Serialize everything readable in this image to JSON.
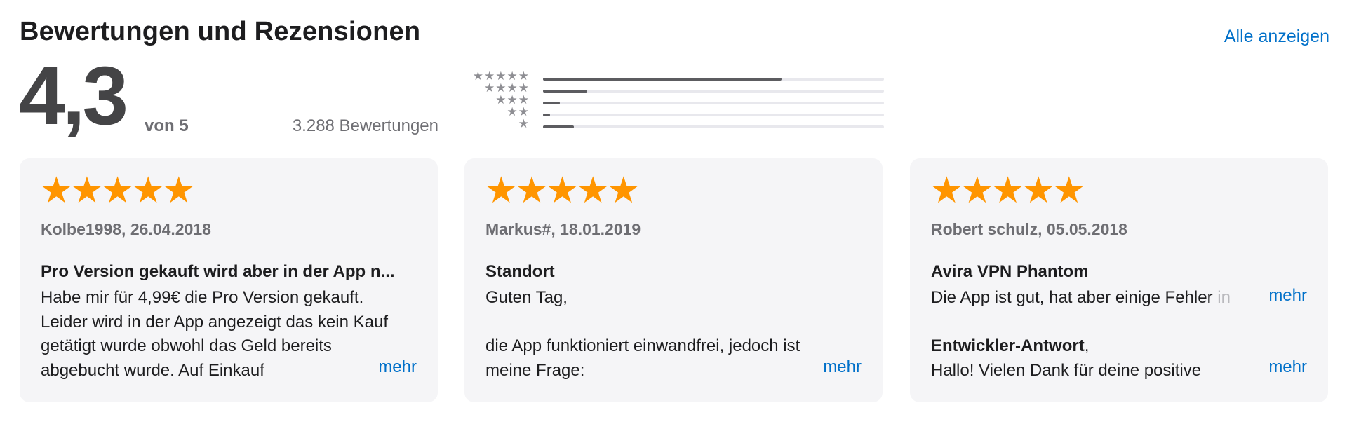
{
  "header": {
    "title": "Bewertungen und Rezensionen",
    "see_all": "Alle anzeigen"
  },
  "summary": {
    "rating": "4,3",
    "out_of": "von 5",
    "count": "3.288 Bewertungen",
    "histogram": [
      {
        "stars": 5,
        "label": "★★★★★",
        "fraction": 0.7
      },
      {
        "stars": 4,
        "label": "★★★★",
        "fraction": 0.13
      },
      {
        "stars": 3,
        "label": "★★★",
        "fraction": 0.05
      },
      {
        "stars": 2,
        "label": "★★",
        "fraction": 0.02
      },
      {
        "stars": 1,
        "label": "★",
        "fraction": 0.09
      }
    ]
  },
  "colors": {
    "accent": "#0070c9",
    "star": "#ff9500",
    "card_bg": "#f5f5f7"
  },
  "reviews": [
    {
      "stars": 5,
      "stars_text": "★★★★★",
      "meta": "Kolbe1998, 26.04.2018",
      "title": "Pro Version gekauft wird aber in der App n...",
      "lines": [
        "Habe mir für 4,99€ die Pro Version gekauft.",
        "Leider wird in der App angezeigt das kein Kauf",
        "getätigt wurde obwohl das Geld bereits",
        "abgebucht wurde. Auf Einkauf"
      ],
      "more": "mehr"
    },
    {
      "stars": 5,
      "stars_text": "★★★★★",
      "meta": "Markus#, 18.01.2019",
      "title": "Standort",
      "lines": [
        "Guten Tag,",
        "",
        "die App funktioniert einwandfrei, jedoch ist",
        "meine Frage:"
      ],
      "more": "mehr"
    },
    {
      "stars": 5,
      "stars_text": "★★★★★",
      "meta": "Robert schulz, 05.05.2018",
      "title": "Avira VPN Phantom",
      "body_line": "Die App ist gut, hat aber einige Fehler",
      "body_tail": " in",
      "more_body": "mehr",
      "dev_label": "Entwickler-Antwort",
      "dev_comma": ",",
      "dev_line": "Hallo! Vielen Dank für deine positive",
      "more": "mehr"
    }
  ]
}
